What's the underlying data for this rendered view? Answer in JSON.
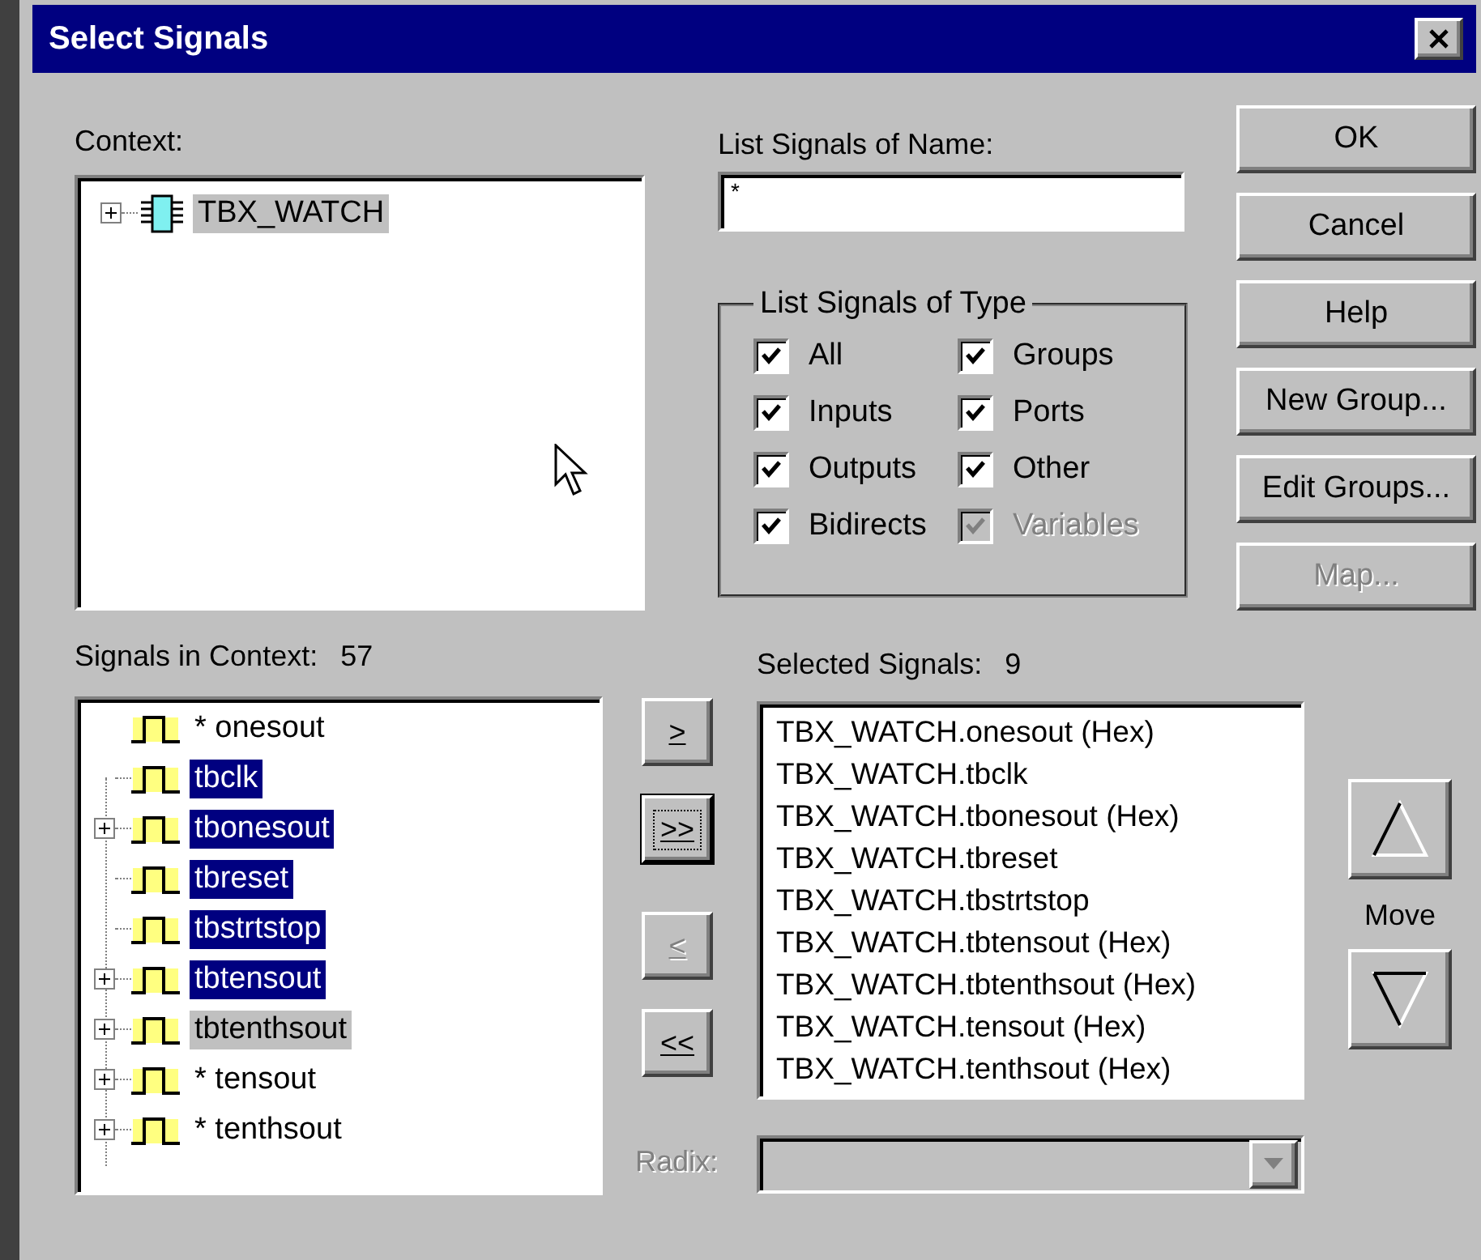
{
  "window": {
    "title": "Select Signals"
  },
  "context": {
    "label": "Context:",
    "items": [
      {
        "name": "TBX_WATCH",
        "expandable": true,
        "current": true
      }
    ]
  },
  "name_filter": {
    "label": "List Signals of Name:",
    "value": "*"
  },
  "type_filter": {
    "label": "List Signals of Type",
    "options": [
      {
        "label": "All",
        "checked": true,
        "disabled": false
      },
      {
        "label": "Groups",
        "checked": true,
        "disabled": false
      },
      {
        "label": "Inputs",
        "checked": true,
        "disabled": false
      },
      {
        "label": "Ports",
        "checked": true,
        "disabled": false
      },
      {
        "label": "Outputs",
        "checked": true,
        "disabled": false
      },
      {
        "label": "Other",
        "checked": true,
        "disabled": false
      },
      {
        "label": "Bidirects",
        "checked": true,
        "disabled": false
      },
      {
        "label": "Variables",
        "checked": true,
        "disabled": true
      }
    ]
  },
  "buttons": [
    {
      "label": "OK",
      "disabled": false
    },
    {
      "label": "Cancel",
      "disabled": false
    },
    {
      "label": "Help",
      "disabled": false
    },
    {
      "label": "New Group...",
      "disabled": false
    },
    {
      "label": "Edit Groups...",
      "disabled": false
    },
    {
      "label": "Map...",
      "disabled": true
    }
  ],
  "signals": {
    "label": "Signals in Context:",
    "count": "57",
    "items": [
      {
        "name": "* onesout",
        "expandable": false,
        "selected": false,
        "current": false
      },
      {
        "name": "tbclk",
        "expandable": false,
        "selected": true,
        "current": false
      },
      {
        "name": "tbonesout",
        "expandable": true,
        "selected": true,
        "current": false
      },
      {
        "name": "tbreset",
        "expandable": false,
        "selected": true,
        "current": false
      },
      {
        "name": "tbstrtstop",
        "expandable": false,
        "selected": true,
        "current": false
      },
      {
        "name": "tbtensout",
        "expandable": true,
        "selected": true,
        "current": false
      },
      {
        "name": "tbtenthsout",
        "expandable": true,
        "selected": false,
        "current": true
      },
      {
        "name": "* tensout",
        "expandable": true,
        "selected": false,
        "current": false
      },
      {
        "name": "* tenthsout",
        "expandable": true,
        "selected": false,
        "current": false
      }
    ]
  },
  "transfer_buttons": [
    {
      "label": ">",
      "disabled": false,
      "focused": false
    },
    {
      "label": ">>",
      "disabled": false,
      "focused": true
    },
    {
      "label": "<",
      "disabled": true,
      "focused": false
    },
    {
      "label": "<<",
      "disabled": false,
      "focused": false
    }
  ],
  "selected": {
    "label": "Selected Signals:",
    "count": "9",
    "items": [
      "TBX_WATCH.onesout (Hex)",
      "TBX_WATCH.tbclk",
      "TBX_WATCH.tbonesout (Hex)",
      "TBX_WATCH.tbreset",
      "TBX_WATCH.tbstrtstop",
      "TBX_WATCH.tbtensout (Hex)",
      "TBX_WATCH.tbtenthsout (Hex)",
      "TBX_WATCH.tensout (Hex)",
      "TBX_WATCH.tenthsout (Hex)"
    ]
  },
  "move": {
    "label": "Move"
  },
  "radix": {
    "label": "Radix:",
    "disabled": true
  }
}
